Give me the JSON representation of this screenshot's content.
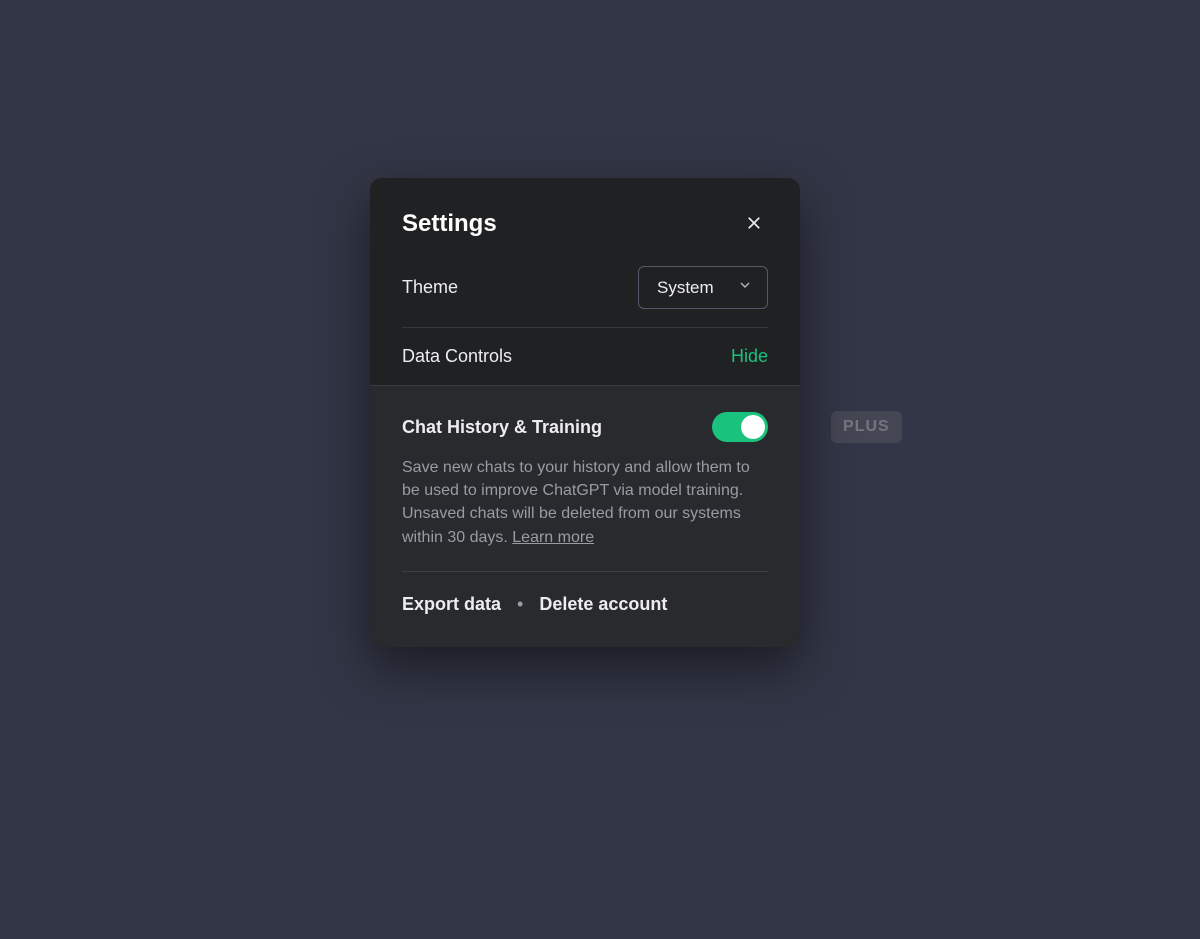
{
  "background": {
    "plus_badge": "PLUS"
  },
  "modal": {
    "title": "Settings",
    "theme": {
      "label": "Theme",
      "selected": "System"
    },
    "data_controls": {
      "label": "Data Controls",
      "toggle_link": "Hide"
    },
    "chat_history": {
      "title": "Chat History & Training",
      "toggle_on": true,
      "description": "Save new chats to your history and allow them to be used to improve ChatGPT via model training. Unsaved chats will be deleted from our systems within 30 days. ",
      "learn_more": "Learn more"
    },
    "actions": {
      "export": "Export data",
      "separator": "•",
      "delete": "Delete account"
    }
  },
  "colors": {
    "accent": "#19c37d",
    "modal_bg": "#202123",
    "panel_bg": "#282a2e",
    "page_bg": "#333646"
  }
}
